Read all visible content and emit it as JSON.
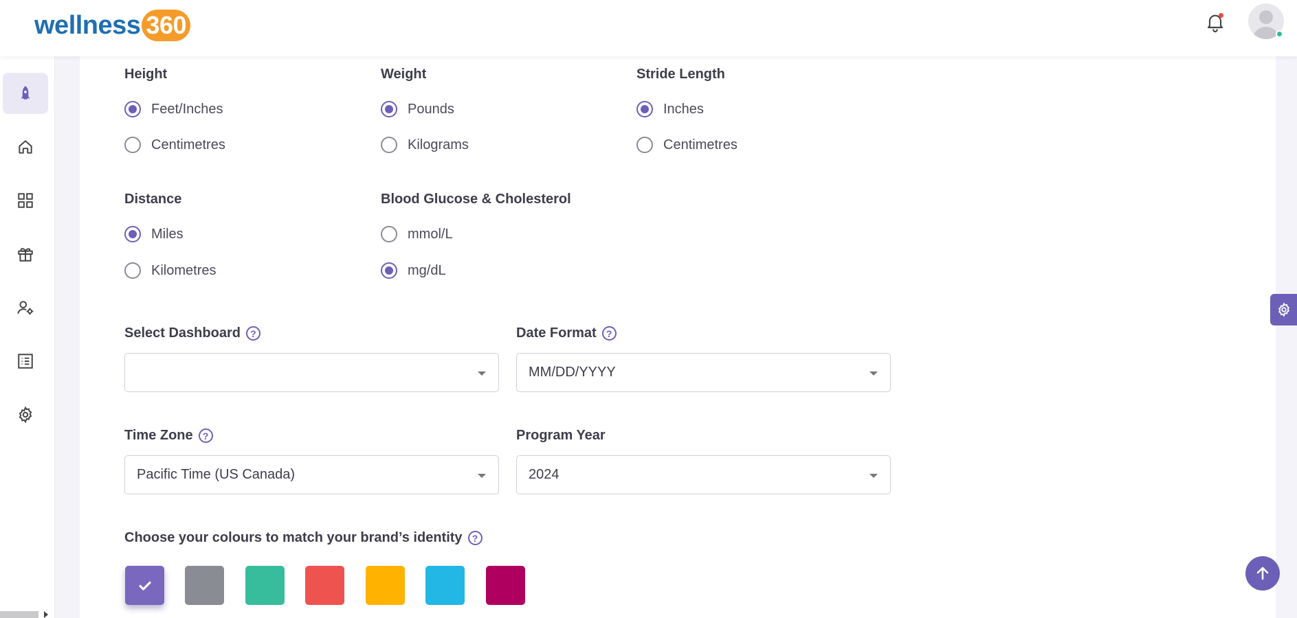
{
  "header": {
    "logo_word": "wellness",
    "logo_number": "360",
    "notification_icon": "bell-icon",
    "avatar_icon": "user-avatar"
  },
  "sidebar": {
    "items": [
      {
        "icon": "rocket-icon",
        "active": true
      },
      {
        "icon": "home-icon",
        "active": false
      },
      {
        "icon": "grid-icon",
        "active": false
      },
      {
        "icon": "gift-icon",
        "active": false
      },
      {
        "icon": "user-settings-icon",
        "active": false
      },
      {
        "icon": "list-icon",
        "active": false
      },
      {
        "icon": "gear-icon",
        "active": false
      }
    ]
  },
  "units": {
    "height": {
      "label": "Height",
      "options": [
        "Feet/Inches",
        "Centimetres"
      ],
      "selected": "Feet/Inches"
    },
    "weight": {
      "label": "Weight",
      "options": [
        "Pounds",
        "Kilograms"
      ],
      "selected": "Pounds"
    },
    "stride": {
      "label": "Stride Length",
      "options": [
        "Inches",
        "Centimetres"
      ],
      "selected": "Inches"
    },
    "distance": {
      "label": "Distance",
      "options": [
        "Miles",
        "Kilometres"
      ],
      "selected": "Miles"
    },
    "glucose": {
      "label": "Blood Glucose & Cholesterol",
      "options": [
        "mmol/L",
        "mg/dL"
      ],
      "selected": "mg/dL"
    }
  },
  "settings": {
    "dashboard": {
      "label": "Select Dashboard",
      "value": ""
    },
    "date_format": {
      "label": "Date Format",
      "value": "MM/DD/YYYY"
    },
    "time_zone": {
      "label": "Time Zone",
      "value": "Pacific Time (US Canada)"
    },
    "program_year": {
      "label": "Program Year",
      "value": "2024"
    },
    "help_glyph": "?"
  },
  "colours": {
    "label": "Choose your colours to match your brand’s identity",
    "swatches": [
      "#7a67be",
      "#8a8c93",
      "#37bd9c",
      "#ef5350",
      "#ffb300",
      "#23b7e5",
      "#b0005f"
    ],
    "selected_index": 0
  },
  "floating": {
    "settings_tab_icon": "gear-icon",
    "scroll_top_icon": "arrow-up-icon"
  }
}
